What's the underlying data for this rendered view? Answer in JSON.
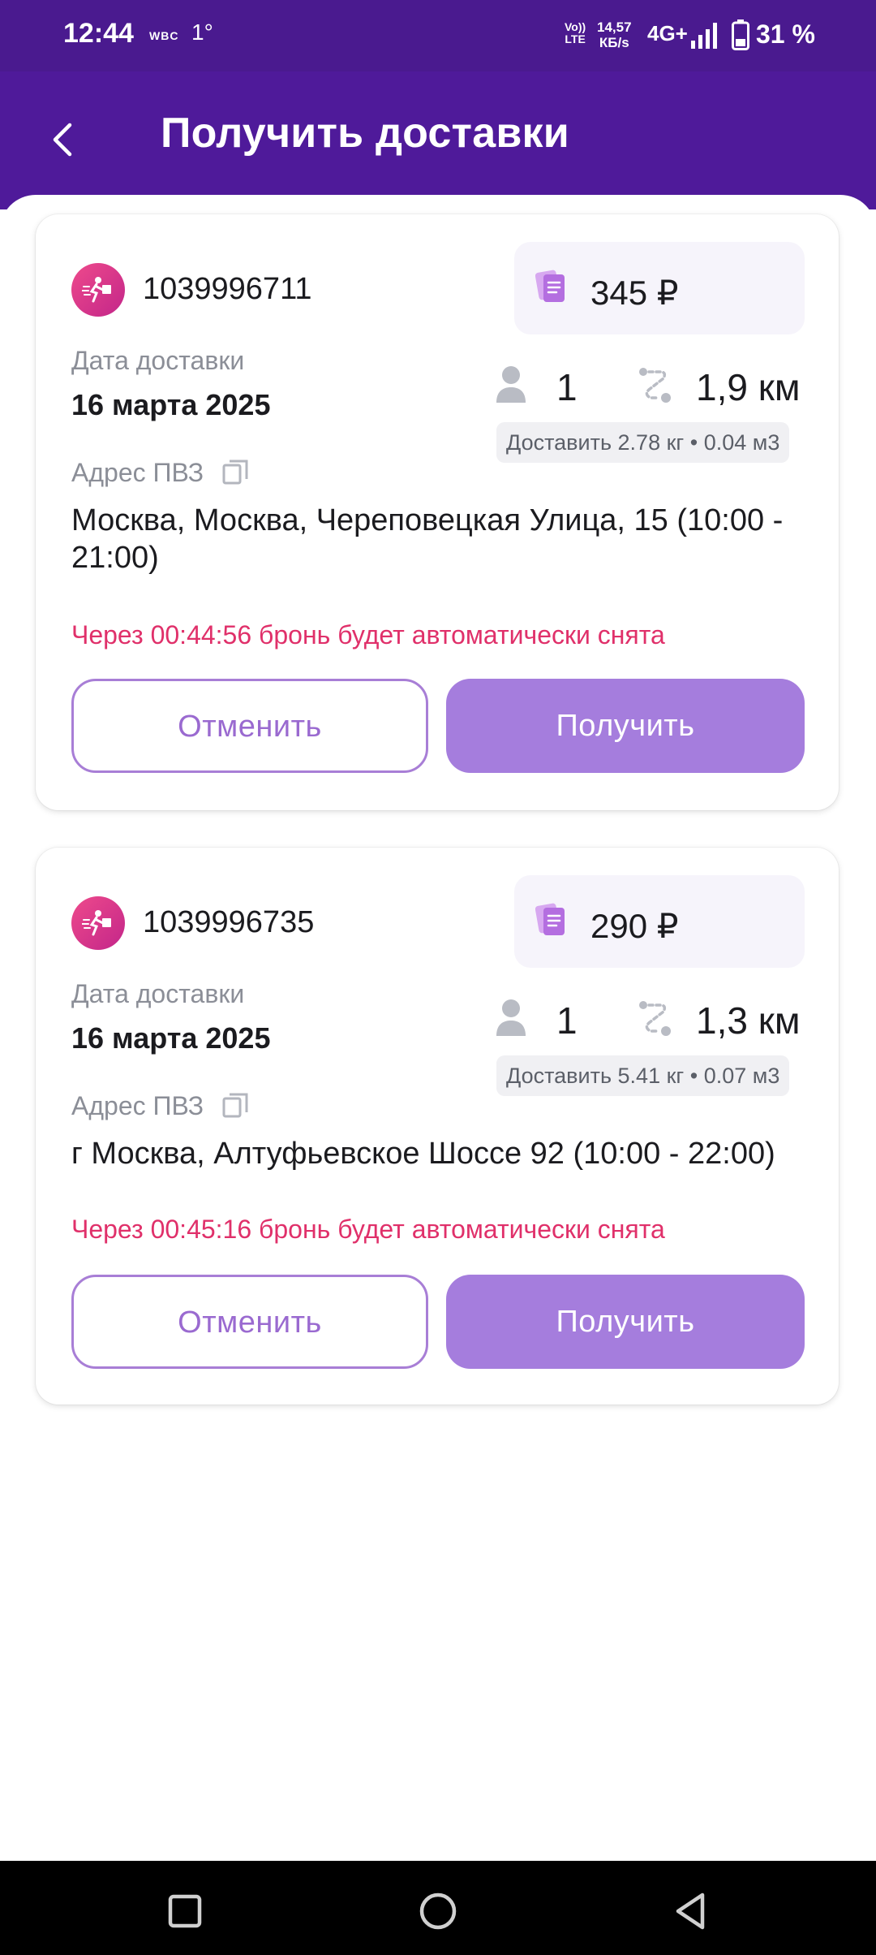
{
  "status_bar": {
    "time": "12:44",
    "carrier_badge": "WBC",
    "temperature": "1°",
    "volte_label_top": "Vo))",
    "volte_label_bottom": "LTE",
    "speed_value": "14,57",
    "speed_unit": "КБ/s",
    "network": "4G+",
    "battery": "31 %"
  },
  "header": {
    "title": "Получить доставки",
    "back_icon": "chevron-left-icon"
  },
  "labels": {
    "delivery_date": "Дата доставки",
    "pickup_address": "Адрес ПВЗ",
    "cancel": "Отменить",
    "receive": "Получить"
  },
  "orders": [
    {
      "id": "1039996711",
      "price": "345 ₽",
      "date": "16 марта 2025",
      "couriers": "1",
      "distance": "1,9 км",
      "cargo": "Доставить 2.78 кг • 0.04 м3",
      "address": "Москва, Москва, Череповецкая Улица, 15 (10:00 - 21:00)",
      "timer": "Через 00:44:56 бронь будет автоматически снята"
    },
    {
      "id": "1039996735",
      "price": "290 ₽",
      "date": "16 марта 2025",
      "couriers": "1",
      "distance": "1,3 км",
      "cargo": "Доставить 5.41 кг • 0.07 м3",
      "address": "г Москва, Алтуфьевское Шоссе 92 (10:00 - 22:00)",
      "timer": "Через 00:45:16 бронь будет автоматически снята"
    }
  ],
  "colors": {
    "header_bg": "#4f1a9a",
    "accent": "#a57ddd",
    "timer": "#e0306a"
  },
  "nav_bar": {
    "icons": [
      "square-recents-icon",
      "circle-home-icon",
      "triangle-back-icon"
    ]
  }
}
